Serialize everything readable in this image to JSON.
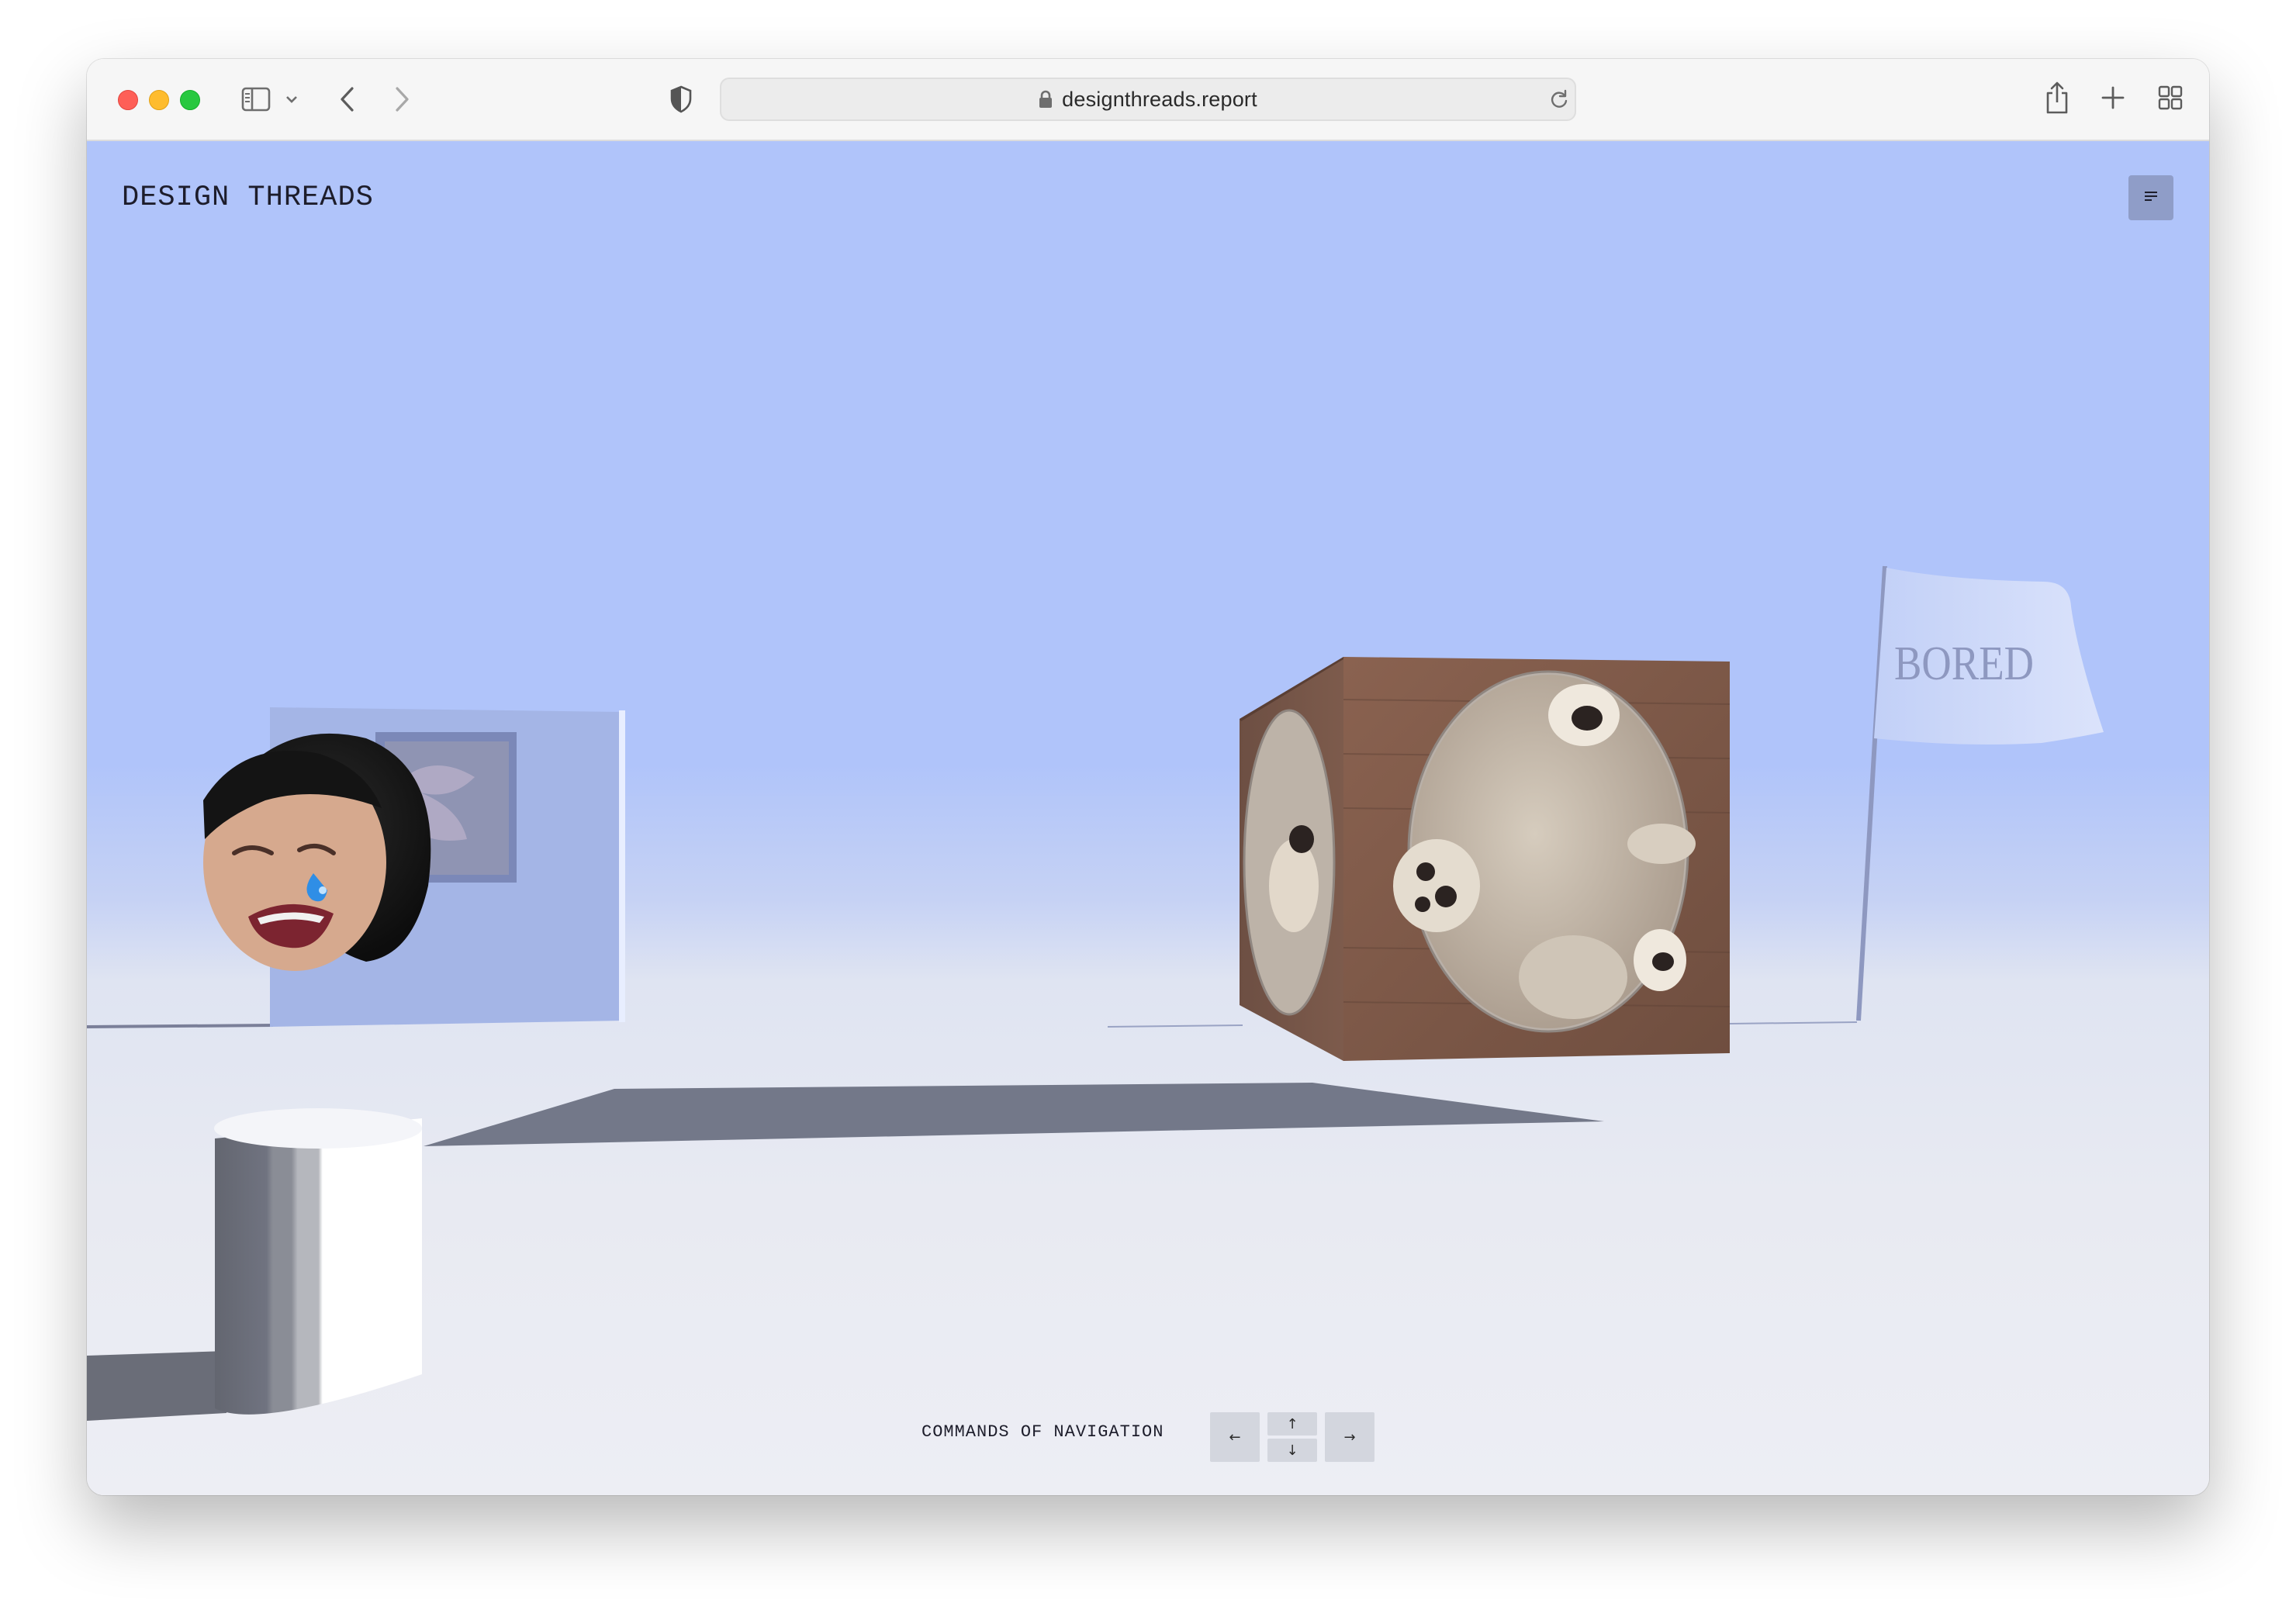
{
  "browser": {
    "url": "designthreads.report",
    "icons": [
      "sidebar-icon",
      "chevron-down-icon",
      "back-icon",
      "forward-icon",
      "shield-icon",
      "lock-icon",
      "reload-icon",
      "share-icon",
      "new-tab-icon",
      "tab-overview-icon"
    ]
  },
  "site": {
    "title": "DESIGN THREADS",
    "menu_icon": "menu-icon"
  },
  "scene": {
    "flag_text": "BORED"
  },
  "navigation": {
    "label": "COMMANDS OF NAVIGATION",
    "left": "←",
    "up": "↑",
    "down": "↓",
    "right": "→"
  },
  "colors": {
    "sky": "#b0c4fa",
    "floor": "#e8eaf2",
    "menu_button": "#8f9dc8"
  }
}
